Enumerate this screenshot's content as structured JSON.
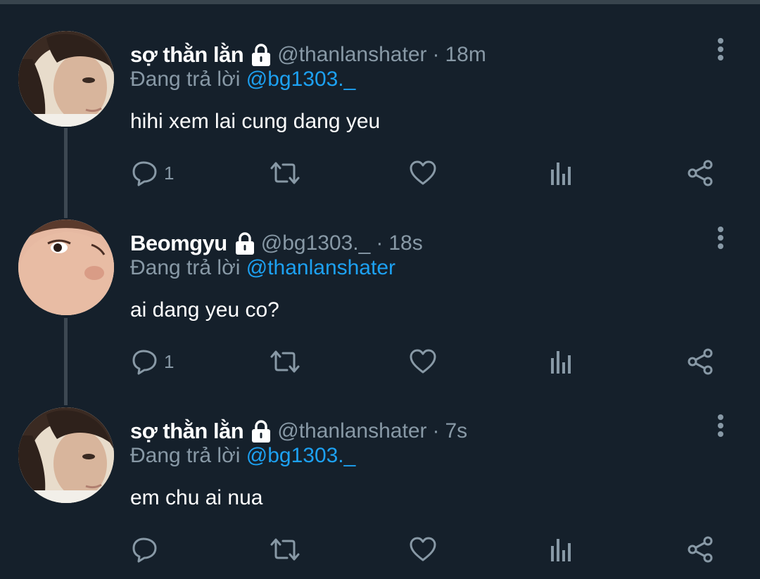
{
  "tweets": [
    {
      "name": "sợ thằn lằn",
      "handle": "@thanlanshater",
      "separator": "·",
      "time": "18m",
      "reply_prefix": "Đang trả lời",
      "reply_to": "@bg1303._",
      "text": "hihi xem lai cung dang yeu",
      "reply_count": "1",
      "avatar": "avatar-dark-hair"
    },
    {
      "name": "Beomgyu",
      "handle": "@bg1303._",
      "separator": "·",
      "time": "18s",
      "reply_prefix": "Đang trả lời",
      "reply_to": "@thanlanshater",
      "text": "ai dang yeu co?",
      "reply_count": "1",
      "avatar": "avatar-closeup"
    },
    {
      "name": "sợ thằn lằn",
      "handle": "@thanlanshater",
      "separator": "·",
      "time": "7s",
      "reply_prefix": "Đang trả lời",
      "reply_to": "@bg1303._",
      "text": "em chu ai nua",
      "reply_count": "",
      "avatar": "avatar-dark-hair"
    }
  ],
  "icons": {
    "lock": "lock-icon",
    "menu": "more-vertical-icon",
    "reply": "reply-icon",
    "retweet": "retweet-icon",
    "like": "heart-icon",
    "analytics": "analytics-icon",
    "share": "share-icon"
  },
  "colors": {
    "background": "#15202b",
    "secondary_text": "#8899a6",
    "link": "#1da1f2",
    "thread_line": "#3d4852"
  }
}
